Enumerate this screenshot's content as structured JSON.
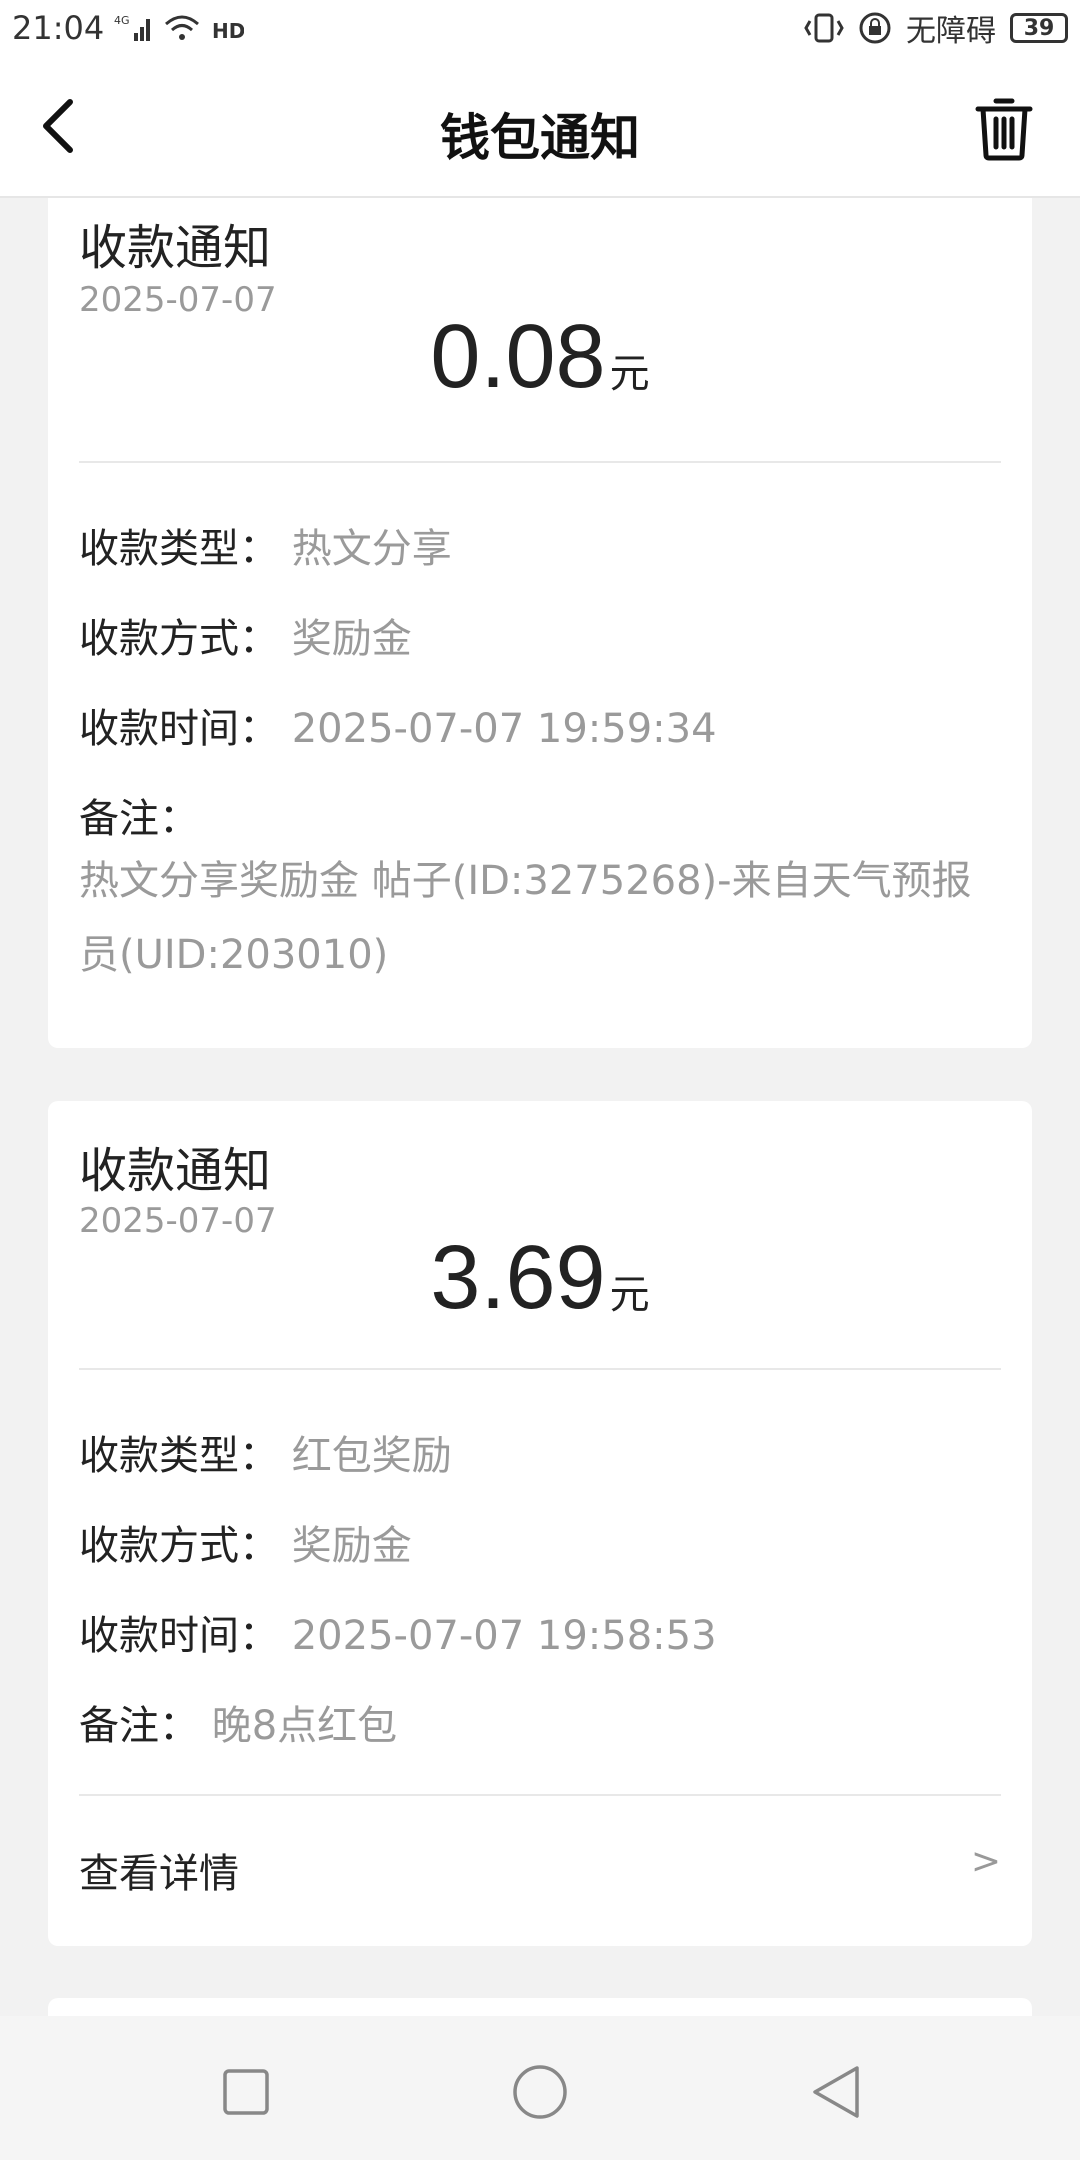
{
  "status_bar": {
    "time": "21:04",
    "network": "4G",
    "accessibility": "无障碍",
    "battery": "39"
  },
  "header": {
    "title": "钱包通知"
  },
  "notifications": [
    {
      "title": "收款通知",
      "date": "2025-07-07",
      "amount": "0.08",
      "unit": "元",
      "type_label": "收款类型：",
      "type_value": "热文分享",
      "method_label": "收款方式：",
      "method_value": "奖励金",
      "time_label": "收款时间：",
      "time_value": "2025-07-07 19:59:34",
      "note_label": "备注：",
      "note_value": "热文分享奖励金 帖子(ID:3275268)-来自天气预报员(UID:203010)"
    },
    {
      "title": "收款通知",
      "date": "2025-07-07",
      "amount": "3.69",
      "unit": "元",
      "type_label": "收款类型：",
      "type_value": "红包奖励",
      "method_label": "收款方式：",
      "method_value": "奖励金",
      "time_label": "收款时间：",
      "time_value": "2025-07-07 19:58:53",
      "note_label": "备注：",
      "note_value": "晚8点红包",
      "detail_label": "查看详情",
      "detail_arrow": ">"
    }
  ]
}
